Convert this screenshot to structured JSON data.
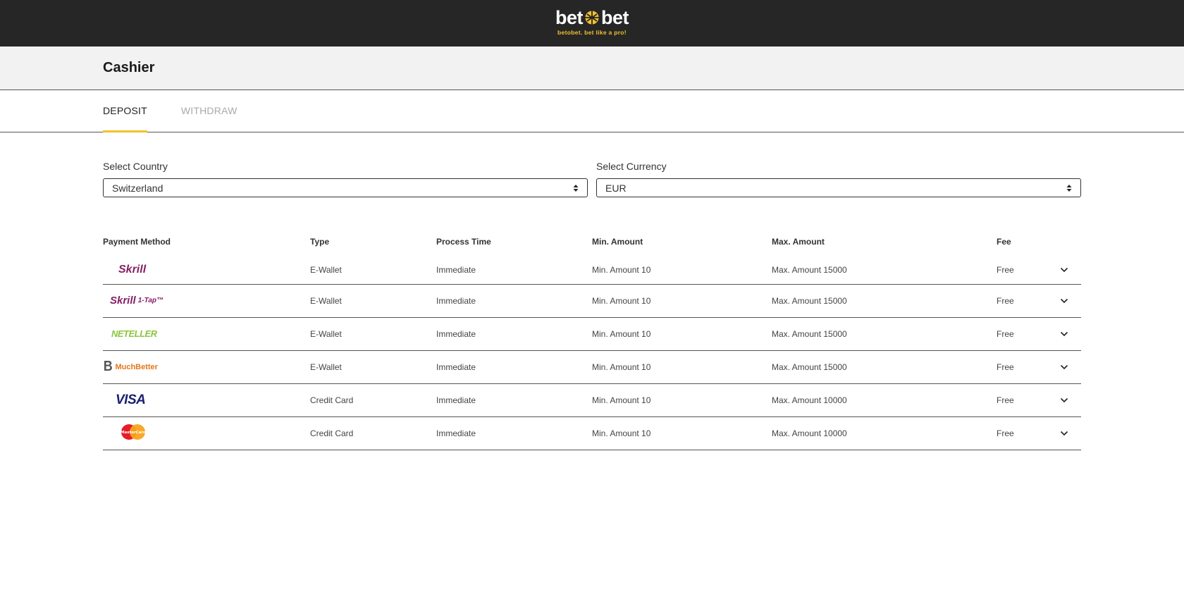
{
  "header": {
    "brand_left": "bet",
    "brand_right": "bet",
    "tagline": "betobet. bet like a pro!",
    "accent_color": "#f2c12e"
  },
  "page": {
    "title": "Cashier"
  },
  "tabs": [
    {
      "label": "DEPOSIT",
      "active": true
    },
    {
      "label": "WITHDRAW",
      "active": false
    }
  ],
  "filters": {
    "country": {
      "label": "Select Country",
      "value": "Switzerland"
    },
    "currency": {
      "label": "Select Currency",
      "value": "EUR"
    }
  },
  "table": {
    "headers": [
      "Payment Method",
      "Type",
      "Process Time",
      "Min. Amount",
      "Max. Amount",
      "Fee"
    ],
    "rows": [
      {
        "method": "Skrill",
        "type": "E-Wallet",
        "process": "Immediate",
        "min": "Min. Amount 10",
        "max": "Max. Amount 15000",
        "fee": "Free"
      },
      {
        "method": "Skrill 1-Tap",
        "type": "E-Wallet",
        "process": "Immediate",
        "min": "Min. Amount 10",
        "max": "Max. Amount 15000",
        "fee": "Free"
      },
      {
        "method": "NETELLER",
        "type": "E-Wallet",
        "process": "Immediate",
        "min": "Min. Amount 10",
        "max": "Max. Amount 15000",
        "fee": "Free"
      },
      {
        "method": "MuchBetter",
        "type": "E-Wallet",
        "process": "Immediate",
        "min": "Min. Amount 10",
        "max": "Max. Amount 15000",
        "fee": "Free"
      },
      {
        "method": "VISA",
        "type": "Credit Card",
        "process": "Immediate",
        "min": "Min. Amount 10",
        "max": "Max. Amount 10000",
        "fee": "Free"
      },
      {
        "method": "MasterCard",
        "type": "Credit Card",
        "process": "Immediate",
        "min": "Min. Amount 10",
        "max": "Max. Amount 10000",
        "fee": "Free"
      }
    ]
  },
  "logo_text": {
    "skrill": "Skrill",
    "skrill1": "Skrill",
    "skrill1_suffix": "1-Tap™",
    "neteller": "NETELLER",
    "muchbetter_mark": "B",
    "muchbetter": "MuchBetter",
    "visa": "VISA",
    "mastercard": "MasterCard"
  }
}
